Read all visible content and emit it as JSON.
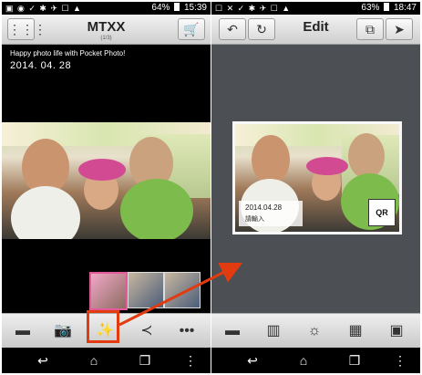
{
  "left": {
    "status": {
      "time": "15:39",
      "battery": "64%"
    },
    "title": "MTXX",
    "page": "(1/3)",
    "caption": "Happy photo life with Pocket Photo!",
    "date": "2014. 04. 28",
    "icons": {
      "menu": "grid-menu-icon",
      "cart": "cart-icon",
      "print": "print-icon",
      "camera": "camera-icon",
      "edit": "magic-wand-icon",
      "share": "share-icon",
      "more": "more-icon"
    }
  },
  "right": {
    "status": {
      "time": "18:47",
      "battery": "63%"
    },
    "title": "Edit",
    "stamp_date": "2014.04.28",
    "stamp_text": "請輸入",
    "qr_label": "QR",
    "icons": {
      "undo": "undo-icon",
      "redo": "redo-icon",
      "rotate": "rotate-icon",
      "send": "send-icon",
      "print": "print-icon",
      "layers": "layers-icon",
      "brightness": "brightness-icon",
      "layout": "layout-icon",
      "frame": "frame-icon"
    }
  },
  "nav": {
    "back": "back-icon",
    "home": "home-icon",
    "recent": "recent-apps-icon",
    "overflow": "overflow-icon"
  },
  "colors": {
    "highlight": "#e23b10",
    "selected_thumb": "#e35a9b",
    "edit_background": "#4c4f54"
  }
}
